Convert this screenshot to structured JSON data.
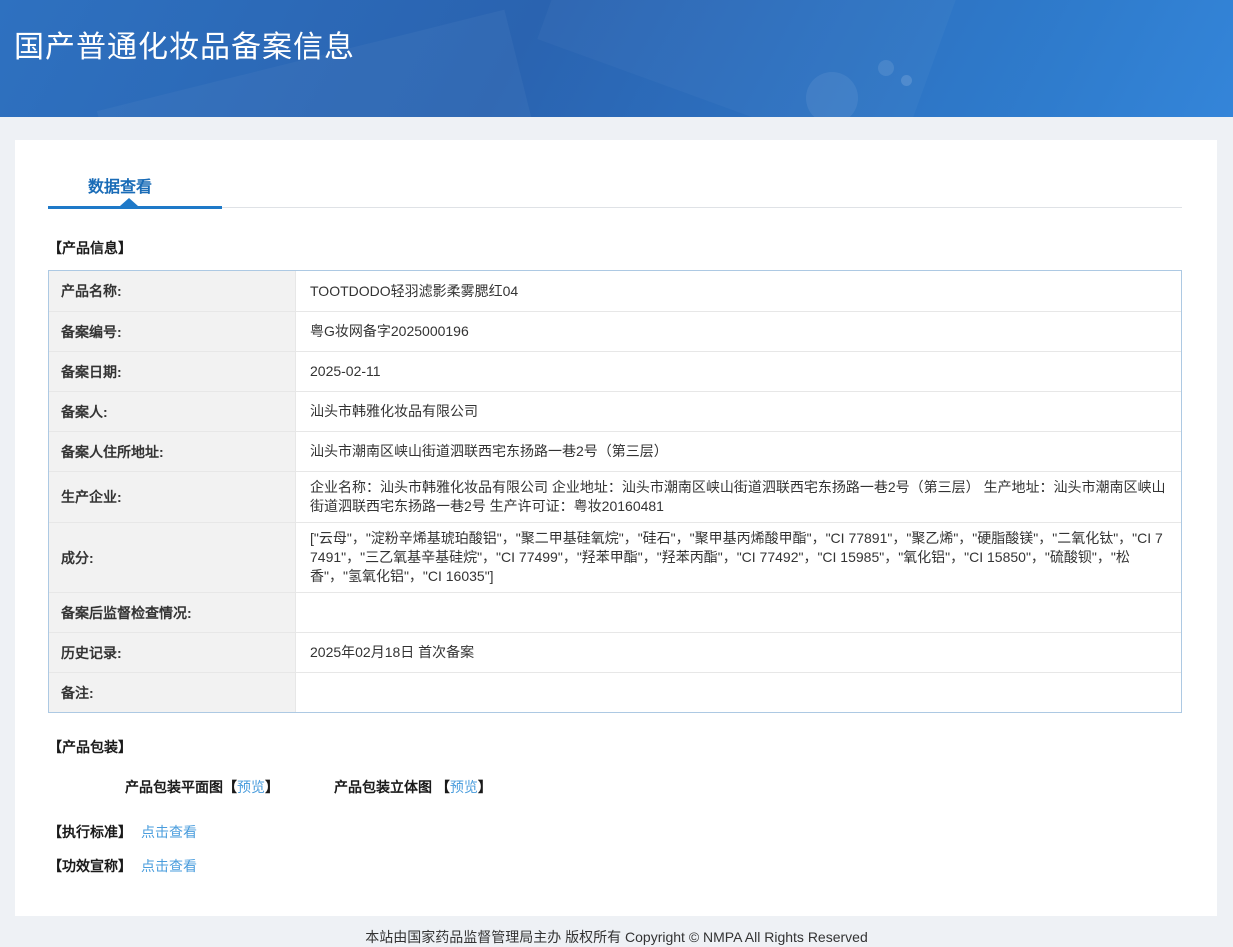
{
  "header": {
    "title": "国产普通化妆品备案信息"
  },
  "tabs": {
    "data_view": "数据查看"
  },
  "product_info": {
    "section_title": "【产品信息】",
    "rows": [
      {
        "label": "产品名称:",
        "value": "TOOTDODO轻羽滤影柔雾腮红04"
      },
      {
        "label": "备案编号:",
        "value": "粤G妆网备字2025000196"
      },
      {
        "label": "备案日期:",
        "value": "2025-02-11"
      },
      {
        "label": "备案人:",
        "value": "汕头市韩雅化妆品有限公司"
      },
      {
        "label": "备案人住所地址:",
        "value": "汕头市潮南区峡山街道泗联西宅东扬路一巷2号（第三层）"
      },
      {
        "label": "生产企业:",
        "value": "企业名称：汕头市韩雅化妆品有限公司 企业地址：汕头市潮南区峡山街道泗联西宅东扬路一巷2号（第三层） 生产地址：汕头市潮南区峡山街道泗联西宅东扬路一巷2号 生产许可证：粤妆20160481"
      },
      {
        "label": "成分:",
        "value": "[\"云母\"，\"淀粉辛烯基琥珀酸铝\"，\"聚二甲基硅氧烷\"，\"硅石\"，\"聚甲基丙烯酸甲酯\"，\"CI 77891\"，\"聚乙烯\"，\"硬脂酸镁\"，\"二氧化钛\"，\"CI 77491\"，\"三乙氧基辛基硅烷\"，\"CI 77499\"，\"羟苯甲酯\"，\"羟苯丙酯\"，\"CI 77492\"，\"CI 15985\"，\"氧化铝\"，\"CI 15850\"，\"硫酸钡\"，\"松香\"，\"氢氧化铝\"，\"CI 16035\"]"
      },
      {
        "label": "备案后监督检查情况:",
        "value": ""
      },
      {
        "label": "历史记录:",
        "value": "2025年02月18日 首次备案"
      },
      {
        "label": "备注:",
        "value": ""
      }
    ]
  },
  "packaging": {
    "section_title": "【产品包装】",
    "bracket_open": "【",
    "bracket_close": "】",
    "items": [
      {
        "label": "产品包装平面图",
        "link": "预览"
      },
      {
        "label": "产品包装立体图 ",
        "link": "预览"
      }
    ]
  },
  "standards": {
    "title": "【执行标准】",
    "link": "点击查看"
  },
  "efficacy": {
    "title": "【功效宣称】",
    "link": "点击查看"
  },
  "footer": {
    "text": "本站由国家药品监督管理局主办 版权所有 Copyright © NMPA All Rights Reserved"
  },
  "colors": {
    "header_gradient_start": "#2a63b0",
    "header_gradient_end": "#3485d9",
    "tab_accent": "#1e79c8",
    "tab_text": "#1a6cb7",
    "link_blue": "#4a9ddd",
    "table_border": "#adc9e3",
    "label_bg": "#f2f2f2",
    "page_bg": "#eef1f5"
  }
}
